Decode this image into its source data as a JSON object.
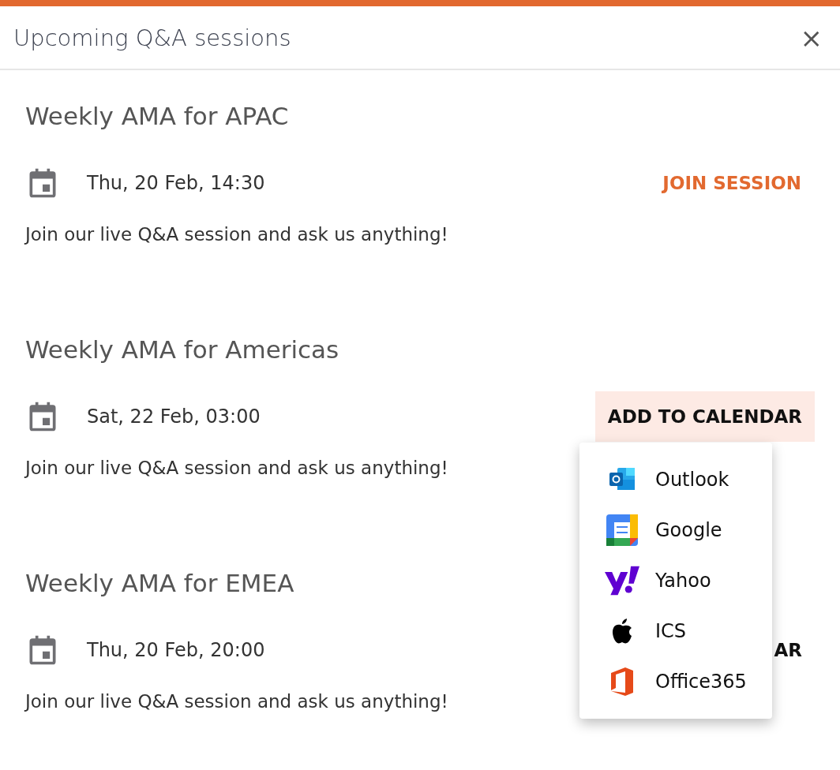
{
  "dialog": {
    "title": "Upcoming Q&A sessions",
    "close": "×"
  },
  "sessions": [
    {
      "title": "Weekly AMA for APAC",
      "date": "Thu, 20 Feb, 14:30",
      "action": {
        "kind": "join",
        "label": "JOIN SESSION",
        "selected": false
      },
      "description": "Join our live Q&A session and ask us anything!"
    },
    {
      "title": "Weekly AMA for Americas",
      "date": "Sat, 22 Feb, 03:00",
      "action": {
        "kind": "calendar",
        "label": "ADD TO CALENDAR",
        "selected": true
      },
      "description": "Join our live Q&A session and ask us anything!"
    },
    {
      "title": "Weekly AMA for EMEA",
      "date": "Thu, 20 Feb, 20:00",
      "action": {
        "kind": "calendar",
        "label": "AR",
        "selected": false
      },
      "description": "Join our live Q&A session and ask us anything!"
    }
  ],
  "calendar_menu": {
    "items": [
      {
        "kind": "outlook",
        "label": "Outlook"
      },
      {
        "kind": "google",
        "label": "Google"
      },
      {
        "kind": "yahoo",
        "label": "Yahoo"
      },
      {
        "kind": "apple",
        "label": "ICS"
      },
      {
        "kind": "office",
        "label": "Office365"
      }
    ]
  }
}
